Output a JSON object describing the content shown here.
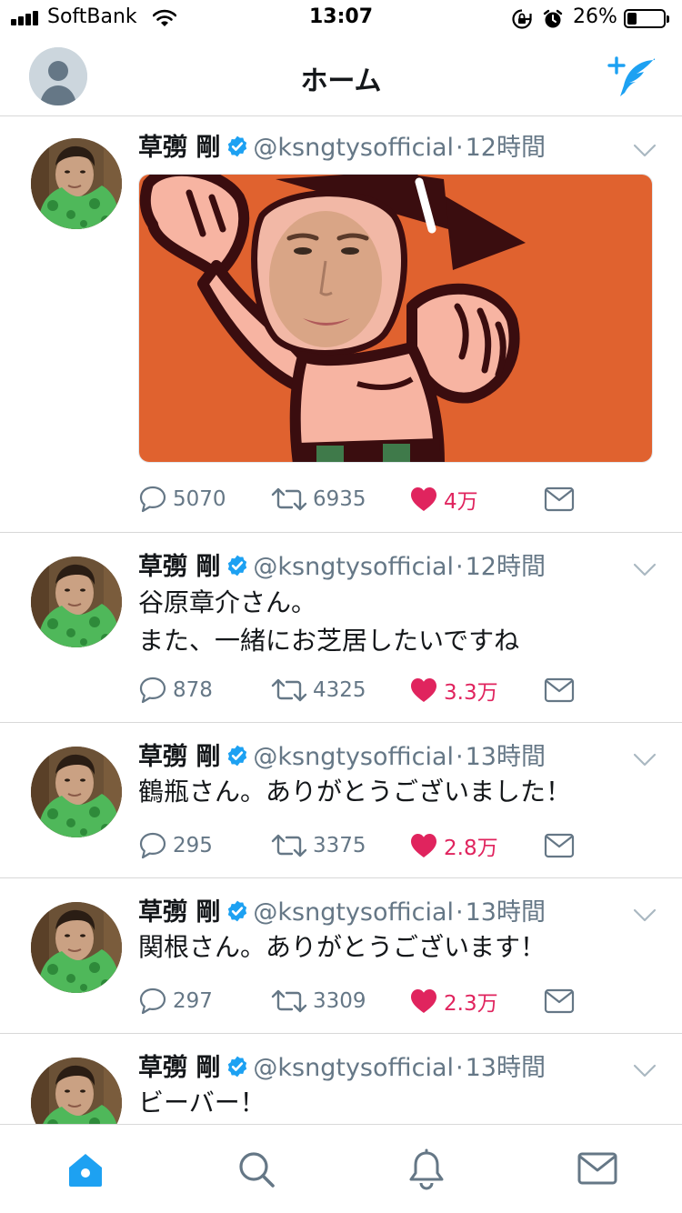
{
  "status_bar": {
    "carrier": "SoftBank",
    "time": "13:07",
    "battery_percent": "26%",
    "battery_level": 0.26,
    "icons": [
      "signal-icon",
      "wifi-icon",
      "rotation-lock-icon",
      "alarm-icon",
      "battery-icon"
    ]
  },
  "nav": {
    "title": "ホーム",
    "icons": [
      "profile-avatar",
      "compose-tweet-icon"
    ]
  },
  "colors": {
    "accent": "#1da1f2",
    "like": "#e0245e",
    "secondary_text": "#657786",
    "media_background": "#e0622f"
  },
  "tweets": [
    {
      "name": "草彅 剛",
      "handle": "@ksngtysofficial",
      "time": "12時間",
      "text": "",
      "has_media": true,
      "replies": "5070",
      "retweets": "6935",
      "likes": "4万",
      "liked": true
    },
    {
      "name": "草彅 剛",
      "handle": "@ksngtysofficial",
      "time": "12時間",
      "text": "谷原章介さん。\nまた、一緒にお芝居したいですね",
      "has_media": false,
      "replies": "878",
      "retweets": "4325",
      "likes": "3.3万",
      "liked": true
    },
    {
      "name": "草彅 剛",
      "handle": "@ksngtysofficial",
      "time": "13時間",
      "text": "鶴瓶さん。ありがとうございました！",
      "has_media": false,
      "replies": "295",
      "retweets": "3375",
      "likes": "2.8万",
      "liked": true
    },
    {
      "name": "草彅 剛",
      "handle": "@ksngtysofficial",
      "time": "13時間",
      "text": "関根さん。ありがとうございます！",
      "has_media": false,
      "replies": "297",
      "retweets": "3309",
      "likes": "2.3万",
      "liked": true
    },
    {
      "name": "草彅 剛",
      "handle": "@ksngtysofficial",
      "time": "13時間",
      "text": "ビーバー！",
      "has_media": false
    }
  ],
  "tab_bar": {
    "items": [
      "home-tab",
      "search-tab",
      "notifications-tab",
      "messages-tab"
    ],
    "active": "home-tab"
  }
}
